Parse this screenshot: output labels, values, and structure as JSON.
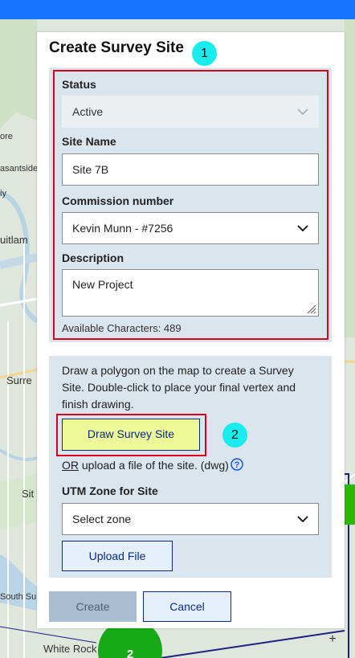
{
  "map": {
    "labels": [
      "ore",
      "asantside",
      "iy",
      "uitlam",
      "Surre",
      "Sit",
      "South Su",
      "White Rock"
    ],
    "cluster_count": "2",
    "zoom_in": "+"
  },
  "panel": {
    "title": "Create Survey Site",
    "step1": "1",
    "step2": "2",
    "status": {
      "label": "Status",
      "value": "Active"
    },
    "site_name": {
      "label": "Site Name",
      "value": "Site 7B"
    },
    "commission": {
      "label": "Commission number",
      "value": "Kevin Munn - #7256"
    },
    "description": {
      "label": "Description",
      "value": "New Project"
    },
    "available_chars": "Available Characters: 489",
    "draw_instructions": "Draw a polygon on the map to create a Survey Site. Double-click to place your final vertex and finish drawing.",
    "draw_button": "Draw Survey Site",
    "upload_or": "OR",
    "upload_text": " upload a file of the site. (dwg)",
    "utm": {
      "label": "UTM Zone for Site",
      "value": "Select zone"
    },
    "upload_button": "Upload File",
    "create_button": "Create",
    "cancel_button": "Cancel"
  },
  "colors": {
    "accent_red": "#d9001b",
    "badge_cyan": "#19ecec",
    "draw_button_bg": "#edf898",
    "section_bg": "#dbe5ee",
    "topbar": "#1673ff",
    "side_tab": "#2bb800"
  }
}
